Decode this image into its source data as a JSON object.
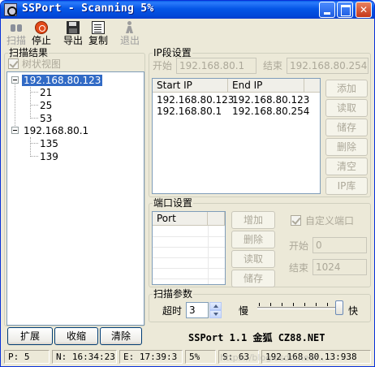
{
  "window": {
    "title": "SSPort - Scanning 5%"
  },
  "title_buttons": {
    "minimize": "minimize",
    "maximize": "maximize",
    "close": "close"
  },
  "toolbar": {
    "scan": {
      "label": "扫描",
      "icon": "binoculars-icon",
      "enabled": false
    },
    "stop": {
      "label": "停止",
      "icon": "stop-icon",
      "enabled": true
    },
    "export": {
      "label": "导出",
      "icon": "floppy-icon",
      "enabled": true
    },
    "copy": {
      "label": "复制",
      "icon": "copy-icon",
      "enabled": true
    },
    "exit": {
      "label": "退出",
      "icon": "exit-icon",
      "enabled": false
    }
  },
  "results": {
    "group_title": "扫描结果",
    "tree_view_label": "树状视图",
    "tree_view_checked": true,
    "tree": [
      {
        "host": "192.168.80.123",
        "selected": true,
        "ports": [
          "21",
          "25",
          "53"
        ]
      },
      {
        "host": "192.168.80.1",
        "selected": false,
        "ports": [
          "135",
          "139"
        ]
      }
    ],
    "buttons": {
      "expand": "扩展",
      "collapse": "收缩",
      "clear": "清除"
    }
  },
  "ip_settings": {
    "group_title": "IP段设置",
    "start_label": "开始",
    "start_value": "192.168.80.1",
    "end_label": "结束",
    "end_value": "192.168.80.254",
    "columns": [
      "Start IP",
      "End IP"
    ],
    "rows": [
      [
        "192.168.80.123",
        "192.168.80.123"
      ],
      [
        "192.168.80.1",
        "192.168.80.254"
      ]
    ],
    "buttons": {
      "add": "添加",
      "read": "读取",
      "save": "储存",
      "delete": "删除",
      "clear": "清空",
      "ip_lib": "IP库"
    }
  },
  "port_settings": {
    "group_title": "端口设置",
    "columns": [
      "Port",
      ""
    ],
    "buttons": {
      "add": "增加",
      "delete": "删除",
      "read": "读取",
      "save": "储存"
    },
    "custom_label": "自定义端口",
    "custom_checked": true,
    "start_label": "开始",
    "start_value": "0",
    "end_label": "结束",
    "end_value": "1024"
  },
  "scan_params": {
    "group_title": "扫描参数",
    "timeout_label": "超时",
    "timeout_value": "3",
    "slow_label": "慢",
    "fast_label": "快",
    "speed_position": "max"
  },
  "brand": "SSPort 1.1  金狐   CZ88.NET",
  "status": {
    "p": "P:  5",
    "n": "N: 16:34:23",
    "e": "E: 17:39:3",
    "percent": "5%",
    "s": "S: 63",
    "current": "192.168.80.13:938"
  },
  "watermark": "https://blog.csdn.net/..."
}
